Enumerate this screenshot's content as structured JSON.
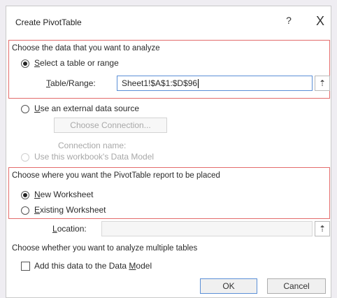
{
  "dialog": {
    "title": "Create PivotTable",
    "help_icon": "?",
    "close_icon": "X"
  },
  "source": {
    "heading": "Choose the data that you want to analyze",
    "option_range": {
      "prefix": "",
      "accel": "S",
      "rest": "elect a table or range",
      "checked": true
    },
    "table_range_label": {
      "accel": "T",
      "rest": "able/Range:"
    },
    "table_range_value": "Sheet1!$A$1:$D$96",
    "option_external": {
      "accel": "U",
      "rest": "se an external data source",
      "checked": false
    },
    "choose_connection_label": "Choose Connection...",
    "connection_name_label": "Connection name:",
    "option_data_model": {
      "label": "Use this workbook's Data Model",
      "enabled": false
    }
  },
  "destination": {
    "heading": "Choose where you want the PivotTable report to be placed",
    "option_new": {
      "accel": "N",
      "rest": "ew Worksheet",
      "checked": true
    },
    "option_existing": {
      "accel": "E",
      "rest": "xisting Worksheet",
      "checked": false
    },
    "location_label": {
      "accel": "L",
      "rest": "ocation:"
    },
    "location_value": ""
  },
  "multiple_tables": {
    "heading": "Choose whether you want to analyze multiple tables",
    "add_to_model": {
      "before": "Add this data to the Data ",
      "accel": "M",
      "after": "odel",
      "checked": false
    }
  },
  "buttons": {
    "ok": "OK",
    "cancel": "Cancel"
  },
  "icons": {
    "range_picker": "⇡",
    "location_picker": "⇡"
  },
  "colors": {
    "highlight_border": "#e36c6c",
    "focus_border": "#5b8fd6"
  }
}
